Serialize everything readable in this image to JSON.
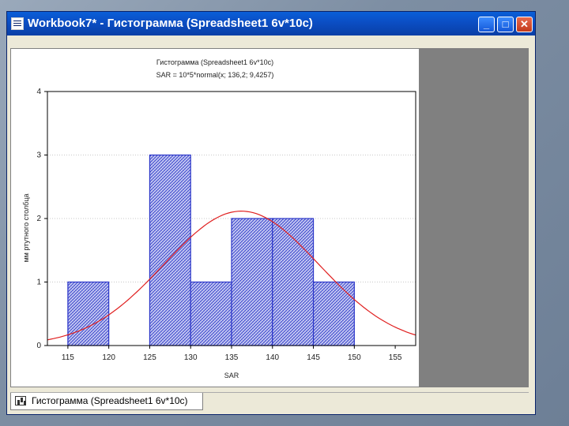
{
  "window": {
    "title": "Workbook7* - Гистограмма (Spreadsheet1 6v*10c)",
    "minimize": "_",
    "maximize": "□",
    "close": "✕"
  },
  "sheet_tab": {
    "label": "Гистограмма (Spreadsheet1 6v*10c)"
  },
  "colors": {
    "bar_fill": "#2a35c8",
    "curve": "#e02020",
    "titlebar": "#0a4fc6"
  },
  "chart_data": {
    "type": "bar",
    "title": "Гистограмма (Spreadsheet1 6v*10c)",
    "subtitle": "SAR = 10*5*normal(x; 136,2; 9,4257)",
    "xlabel": "SAR",
    "ylabel": "мм ртутного столбца",
    "xlim": [
      112.5,
      157.5
    ],
    "ylim": [
      0,
      4
    ],
    "xticks": [
      115,
      120,
      125,
      130,
      135,
      140,
      145,
      150,
      155
    ],
    "yticks": [
      0,
      1,
      2,
      3,
      4
    ],
    "bins": [
      {
        "from": 115,
        "to": 120,
        "count": 1
      },
      {
        "from": 120,
        "to": 125,
        "count": 0
      },
      {
        "from": 125,
        "to": 130,
        "count": 3
      },
      {
        "from": 130,
        "to": 135,
        "count": 1
      },
      {
        "from": 135,
        "to": 140,
        "count": 2
      },
      {
        "from": 140,
        "to": 145,
        "count": 2
      },
      {
        "from": 145,
        "to": 150,
        "count": 1
      }
    ],
    "fit": {
      "distribution": "normal",
      "mean": 136.2,
      "sd": 9.4257,
      "scale": 50
    },
    "grid": true
  }
}
